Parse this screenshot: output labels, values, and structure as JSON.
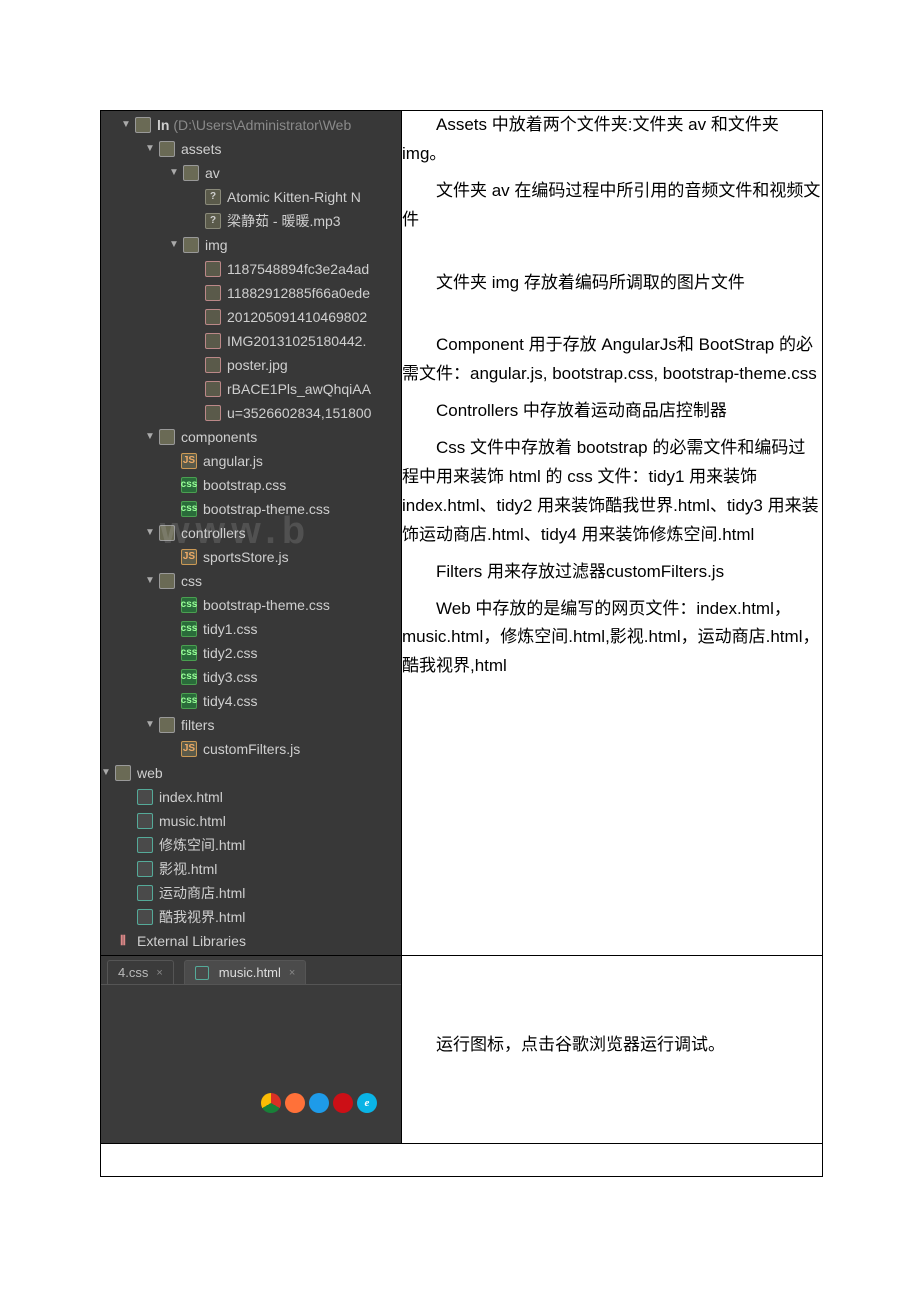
{
  "tree": {
    "root": {
      "label": "ln",
      "path": "(D:\\Users\\Administrator\\Web"
    },
    "assets": {
      "label": "assets"
    },
    "av": {
      "label": "av"
    },
    "av_files": [
      "Atomic Kitten-Right N",
      "梁静茹 - 暖暖.mp3"
    ],
    "img": {
      "label": "img"
    },
    "img_files": [
      "1187548894fc3e2a4ad",
      "11882912885f66a0ede",
      "201205091410469802",
      "IMG20131025180442.",
      "poster.jpg",
      "rBACE1Pls_awQhqiAA",
      "u=3526602834,151800"
    ],
    "components": {
      "label": "components"
    },
    "components_files": [
      {
        "name": "angular.js",
        "type": "js"
      },
      {
        "name": "bootstrap.css",
        "type": "css"
      },
      {
        "name": "bootstrap-theme.css",
        "type": "css"
      }
    ],
    "controllers": {
      "label": "controllers"
    },
    "controllers_files": [
      {
        "name": "sportsStore.js",
        "type": "js"
      }
    ],
    "css": {
      "label": "css"
    },
    "css_files": [
      {
        "name": "bootstrap-theme.css",
        "type": "css"
      },
      {
        "name": "tidy1.css",
        "type": "css"
      },
      {
        "name": "tidy2.css",
        "type": "css"
      },
      {
        "name": "tidy3.css",
        "type": "css"
      },
      {
        "name": "tidy4.css",
        "type": "css"
      }
    ],
    "filters": {
      "label": "filters"
    },
    "filters_files": [
      {
        "name": "customFilters.js",
        "type": "js"
      }
    ],
    "web": {
      "label": "web"
    },
    "web_files": [
      "index.html",
      "music.html",
      "修炼空间.html",
      "影视.html",
      "运动商店.html",
      "酷我视界.html"
    ],
    "ext_lib": "External Libraries"
  },
  "tabs": {
    "t1": "4.css",
    "t2": "music.html"
  },
  "desc": {
    "p1": "Assets 中放着两个文件夹:文件夹 av 和文件夹 img。",
    "p2": "文件夹 av 在编码过程中所引用的音频文件和视频文件",
    "p3": "文件夹 img 存放着编码所调取的图片文件",
    "p4": "Component 用于存放 AngularJs和 BootStrap 的必需文件：angular.js, bootstrap.css, bootstrap-theme.css",
    "p5": "Controllers 中存放着运动商品店控制器",
    "p6": "Css 文件中存放着 bootstrap 的必需文件和编码过程中用来装饰 html 的 css 文件：tidy1 用来装饰 index.html、tidy2 用来装饰酷我世界.html、tidy3 用来装饰运动商店.html、tidy4 用来装饰修炼空间.html",
    "p7": "Filters 用来存放过滤器customFilters.js",
    "p8": "Web 中存放的是编写的网页文件：index.html，music.html，修炼空间.html,影视.html，运动商店.html，酷我视界,html",
    "p9": "运行图标，点击谷歌浏览器运行调试。"
  },
  "watermark": "www.b"
}
